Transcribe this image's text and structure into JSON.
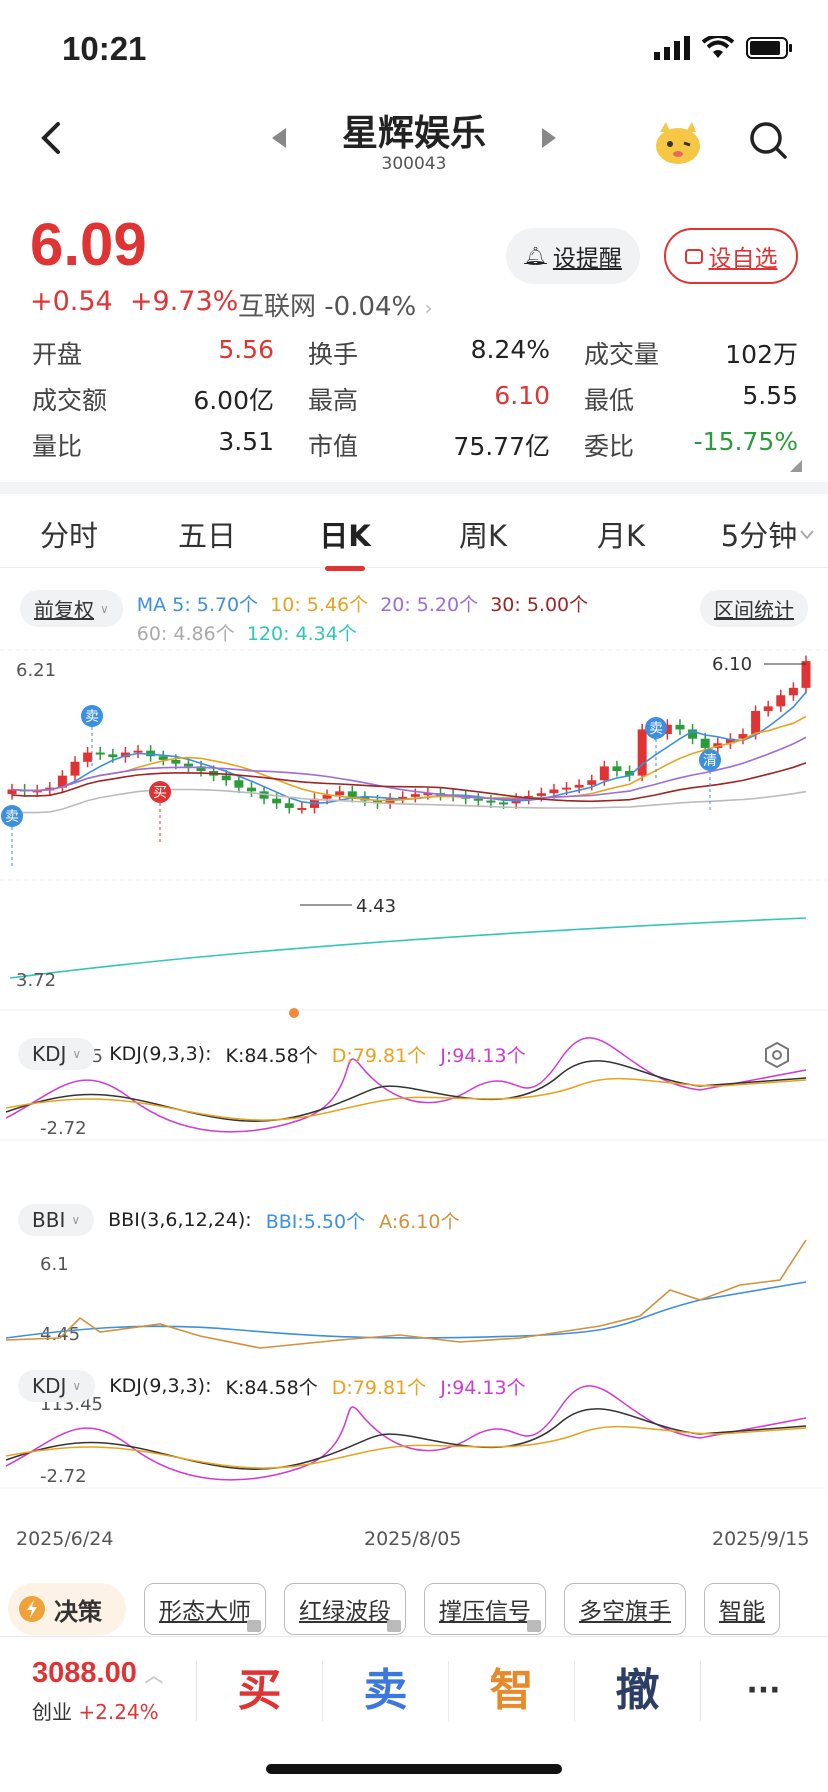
{
  "status": {
    "time": "10:21"
  },
  "header": {
    "title": "星辉娱乐",
    "code": "300043"
  },
  "quote": {
    "price": "6.09",
    "change": "+0.54",
    "change_pct": "+9.73%",
    "sector": "互联网",
    "sector_pct": "-0.04%",
    "alert_label": "设提醒",
    "fav_label": "设自选"
  },
  "stats": [
    [
      {
        "label": "开盘",
        "value": "5.56",
        "color": "#e03434"
      },
      {
        "label": "换手",
        "value": "8.24%",
        "color": "#222"
      },
      {
        "label": "成交量",
        "value": "102万",
        "color": "#222"
      }
    ],
    [
      {
        "label": "成交额",
        "value": "6.00亿",
        "color": "#222"
      },
      {
        "label": "最高",
        "value": "6.10",
        "color": "#e03434"
      },
      {
        "label": "最低",
        "value": "5.55",
        "color": "#222"
      }
    ],
    [
      {
        "label": "量比",
        "value": "3.51",
        "color": "#222"
      },
      {
        "label": "市值",
        "value": "75.77亿",
        "color": "#222"
      },
      {
        "label": "委比",
        "value": "-15.75%",
        "color": "#2a9d3a"
      }
    ]
  ],
  "tabs": [
    "分时",
    "五日",
    "日K",
    "周K",
    "月K",
    "5分钟"
  ],
  "legend": {
    "adjust": "前复权",
    "range_stats": "区间统计",
    "ma5": "MA 5: 5.70个",
    "ma10": "10: 5.46个",
    "ma20": "20: 5.20个",
    "ma30": "30: 5.00个",
    "ma60": "60: 4.86个",
    "ma120": "120: 4.34个"
  },
  "chart_data": {
    "type": "candlestick",
    "ymax_label": "6.21",
    "ymin_label": "3.72",
    "ylim": [
      3.72,
      6.21
    ],
    "high_marker": "6.10",
    "low_marker": "4.43",
    "x_labels": [
      "2025/6/24",
      "2025/8/05",
      "2025/9/15"
    ],
    "signals": [
      "卖",
      "卖",
      "买",
      "卖",
      "清"
    ],
    "kdj1": {
      "selector": "KDJ",
      "params": "KDJ(9,3,3):",
      "k": "K:84.58个",
      "d": "D:79.81个",
      "j": "J:94.13个",
      "ymax": "113.45",
      "ymin": "-2.72"
    },
    "bbi": {
      "selector": "BBI",
      "params": "BBI(3,6,12,24):",
      "bbi": "BBI:5.50个",
      "a": "A:6.10个",
      "ymax": "6.1",
      "ymin": "4.45"
    },
    "kdj2": {
      "selector": "KDJ",
      "params": "KDJ(9,3,3):",
      "k": "K:84.58个",
      "d": "D:79.81个",
      "j": "J:94.13个",
      "ymax": "113.45",
      "ymin": "-2.72"
    }
  },
  "tools": {
    "juece": "决策",
    "items": [
      "形态大师",
      "红绿波段",
      "撑压信号",
      "多空旗手",
      "智能"
    ]
  },
  "trade": {
    "index_value": "3088.00",
    "index_name": "创业",
    "index_pct": "+2.24%",
    "buy": "买",
    "sell": "卖",
    "smart": "智",
    "cancel": "撤",
    "more": "···"
  }
}
